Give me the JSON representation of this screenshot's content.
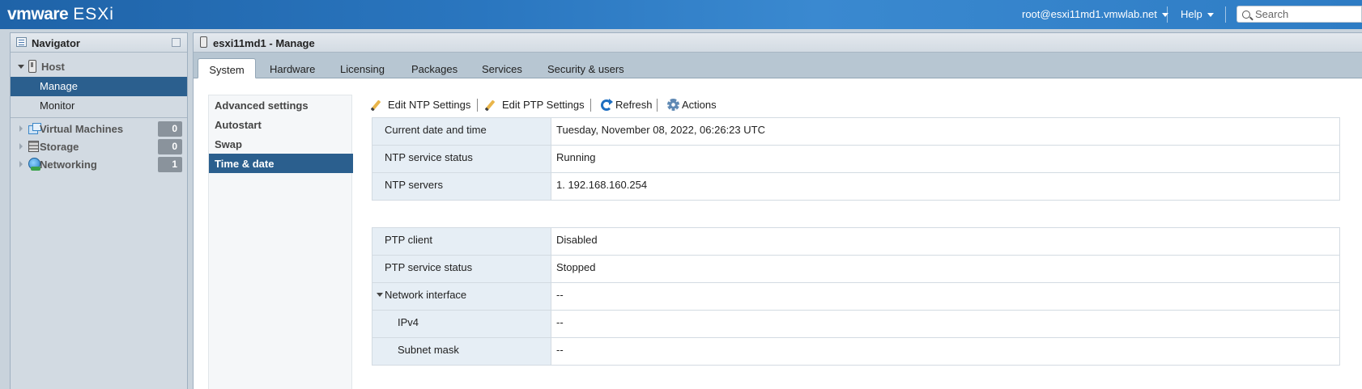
{
  "topbar": {
    "brand": "vmware",
    "product": "ESXi",
    "user": "root@esxi11md1.vmwlab.net",
    "help": "Help",
    "search_placeholder": "Search"
  },
  "navigator": {
    "title": "Navigator",
    "host": {
      "label": "Host"
    },
    "host_children": [
      {
        "label": "Manage"
      },
      {
        "label": "Monitor"
      }
    ],
    "items": [
      {
        "label": "Virtual Machines",
        "count": "0"
      },
      {
        "label": "Storage",
        "count": "0"
      },
      {
        "label": "Networking",
        "count": "1"
      }
    ]
  },
  "main": {
    "title": "esxi11md1 - Manage",
    "tabs": [
      {
        "label": "System"
      },
      {
        "label": "Hardware"
      },
      {
        "label": "Licensing"
      },
      {
        "label": "Packages"
      },
      {
        "label": "Services"
      },
      {
        "label": "Security & users"
      }
    ],
    "subnav": [
      {
        "label": "Advanced settings"
      },
      {
        "label": "Autostart"
      },
      {
        "label": "Swap"
      },
      {
        "label": "Time & date"
      }
    ],
    "toolbar": {
      "edit_ntp": "Edit NTP Settings",
      "edit_ptp": "Edit PTP Settings",
      "refresh": "Refresh",
      "actions": "Actions"
    },
    "ntp_table": [
      {
        "label": "Current date and time",
        "value": "Tuesday, November 08, 2022, 06:26:23 UTC"
      },
      {
        "label": "NTP service status",
        "value": "Running"
      },
      {
        "label": "NTP servers",
        "value": "1. 192.168.160.254"
      }
    ],
    "ptp_table": [
      {
        "label": "PTP client",
        "value": "Disabled"
      },
      {
        "label": "PTP service status",
        "value": "Stopped"
      },
      {
        "label": "Network interface",
        "value": "--"
      },
      {
        "label": "IPv4",
        "value": "--"
      },
      {
        "label": "Subnet mask",
        "value": "--"
      }
    ]
  }
}
